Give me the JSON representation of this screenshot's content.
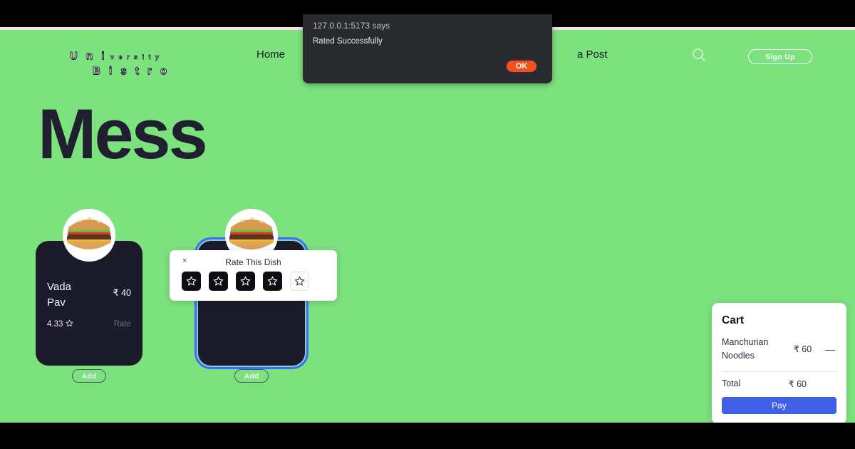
{
  "colors": {
    "page_background": "#7ce27e",
    "card_background": "#1b1b2b",
    "accent_blue": "#3f5fe8",
    "alert_ok_orange": "#f4511e",
    "focus_ring_blue": "#3d6ef5",
    "title_dark": "#201f30"
  },
  "header": {
    "logo": {
      "line1_big": "U n i",
      "line1_small": "v e r s i t y",
      "line2_big": "B i s t r o"
    },
    "nav": [
      {
        "label": "Home",
        "name": "nav-item-home"
      },
      {
        "label": "a Post",
        "name": "nav-item-create-a-post"
      }
    ],
    "search_icon": "search-icon",
    "signup_label": "Sign Up"
  },
  "main": {
    "page_title": "Mess",
    "cards": [
      {
        "name": "Vada Pav",
        "price": "₹ 40",
        "rating": "4.33",
        "rate_label": "Rate",
        "add_label": "Add",
        "star_icon": "star-outline-icon",
        "image_icon": "burger-image"
      },
      {
        "name": "",
        "price": "",
        "rating": "",
        "rate_label": "",
        "add_label": "Add",
        "star_icon": "star-outline-icon",
        "image_icon": "burger-image"
      }
    ]
  },
  "rate_popup": {
    "close_label": "×",
    "title": "Rate This Dish",
    "stars": [
      {
        "state": "filled",
        "value": "1"
      },
      {
        "state": "filled",
        "value": "2"
      },
      {
        "state": "filled",
        "value": "3"
      },
      {
        "state": "filled",
        "value": "4"
      },
      {
        "state": "empty",
        "value": "5"
      }
    ]
  },
  "cart": {
    "title": "Cart",
    "items": [
      {
        "name": "Manchurian Noodles",
        "price": "₹ 60",
        "remove_label": "—"
      }
    ],
    "total_label": "Total",
    "total_value": "₹ 60",
    "pay_label": "Pay"
  },
  "alert_dialog": {
    "origin": "127.0.0.1:5173 says",
    "message": "Rated Successfully",
    "ok_label": "OK"
  }
}
